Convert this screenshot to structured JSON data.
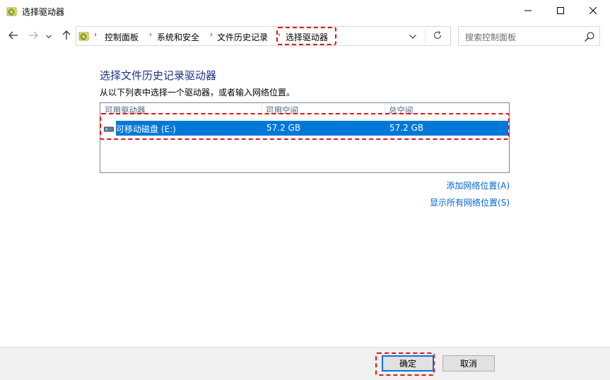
{
  "window": {
    "title": "选择驱动器",
    "minimize_icon": "minimize-icon",
    "maximize_icon": "maximize-icon",
    "close_icon": "close-icon"
  },
  "nav": {
    "back_icon": "arrow-left-icon",
    "forward_icon": "arrow-right-icon",
    "recent_icon": "chevron-down-icon",
    "up_icon": "arrow-up-icon",
    "breadcrumbs": [
      "控制面板",
      "系统和安全",
      "文件历史记录",
      "选择驱动器"
    ],
    "refresh_icon": "refresh-icon",
    "search_placeholder": "搜索控制面板"
  },
  "main": {
    "heading": "选择文件历史记录驱动器",
    "instruction": "从以下列表中选择一个驱动器，或者输入网络位置。",
    "columns": [
      "可用驱动器",
      "可用空间",
      "总空间"
    ],
    "rows": [
      {
        "drive": "可移动磁盘 (E:)",
        "free": "57.2 GB",
        "total": "57.2 GB",
        "selected": true
      }
    ],
    "links": {
      "add_network": "添加网络位置(A)",
      "show_all_network": "显示所有网络位置(S)"
    }
  },
  "footer": {
    "ok_label": "确定",
    "cancel_label": "取消"
  },
  "colors": {
    "accent": "#0078d7",
    "heading": "#1e3287",
    "link": "#0066cc",
    "annotation": "#e0141e"
  }
}
